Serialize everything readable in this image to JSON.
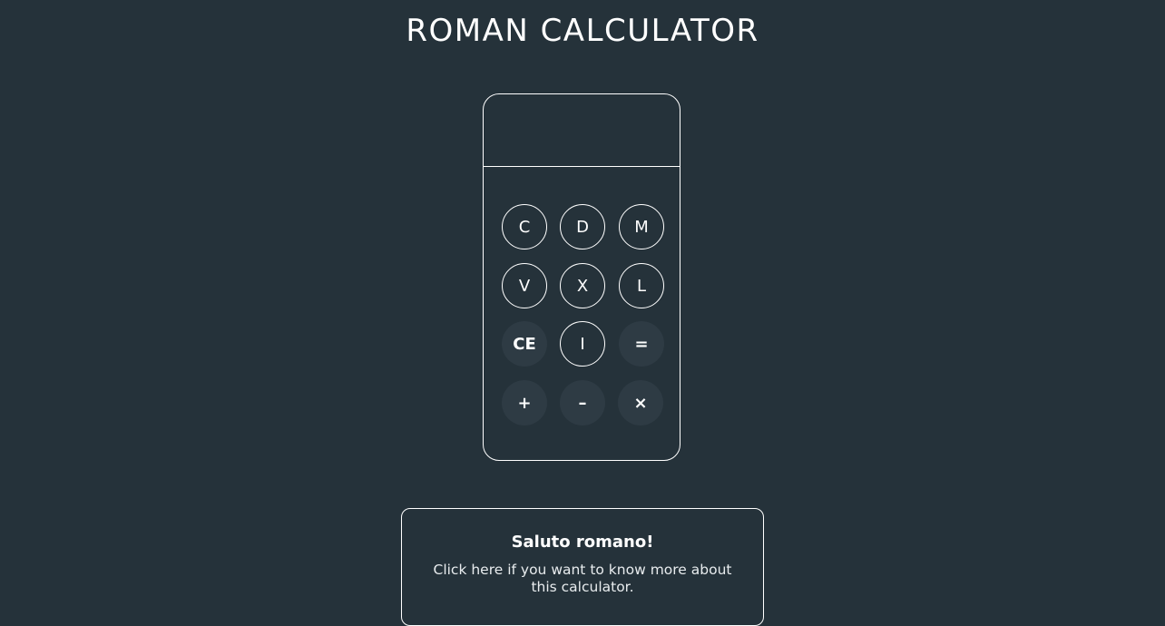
{
  "header": {
    "title": "ROMAN CALCULATOR"
  },
  "calculator": {
    "display_value": "",
    "keys": [
      {
        "label": "C",
        "kind": "numeral"
      },
      {
        "label": "D",
        "kind": "numeral"
      },
      {
        "label": "M",
        "kind": "numeral"
      },
      {
        "label": "V",
        "kind": "numeral"
      },
      {
        "label": "X",
        "kind": "numeral"
      },
      {
        "label": "L",
        "kind": "numeral"
      },
      {
        "label": "CE",
        "kind": "op"
      },
      {
        "label": "I",
        "kind": "numeral"
      },
      {
        "label": "=",
        "kind": "op"
      },
      {
        "label": "+",
        "kind": "op"
      },
      {
        "label": "–",
        "kind": "op"
      },
      {
        "label": "×",
        "kind": "op"
      }
    ]
  },
  "info": {
    "heading": "Saluto romano!",
    "text": "Click here if you want to know more about this calculator."
  },
  "colors": {
    "background": "#25323a",
    "operator_key": "#2e3b44",
    "foreground": "#ffffff"
  }
}
